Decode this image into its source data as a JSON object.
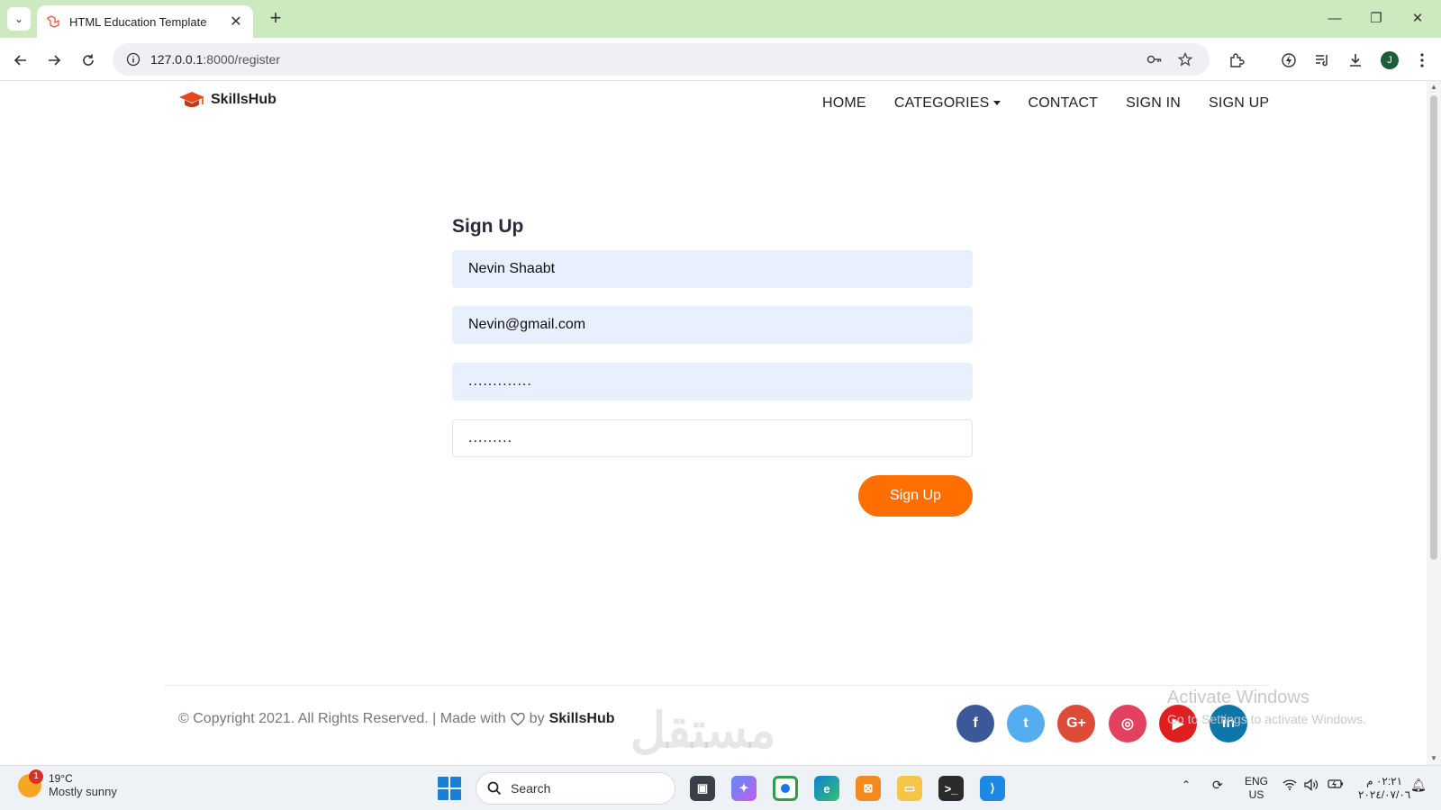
{
  "browser": {
    "tab_title": "HTML Education Template",
    "tab_close": "✕",
    "new_tab": "+",
    "url_host": "127.0.0.1",
    "url_path": ":8000/register",
    "window_controls": {
      "minimize": "—",
      "restore": "❐",
      "close": "✕"
    }
  },
  "site": {
    "logo_text": "SkillsHub",
    "nav": [
      {
        "label": "HOME"
      },
      {
        "label": "CATEGORIES",
        "dropdown": true
      },
      {
        "label": "CONTACT"
      },
      {
        "label": "SIGN IN"
      },
      {
        "label": "SIGN UP"
      }
    ],
    "accent_color": "#ff6f00"
  },
  "form": {
    "title": "Sign Up",
    "name_value": "Nevin Shaabt",
    "email_value": "Nevin@gmail.com",
    "password_value": ".............",
    "confirm_value": ".........",
    "submit_label": "Sign Up"
  },
  "footer": {
    "copyright_prefix": "© Copyright 2021. All Rights Reserved. | Made with",
    "copyright_by": "by",
    "brand": "SkillsHub",
    "social": [
      {
        "name": "facebook",
        "glyph": "f",
        "color": "#3b5998"
      },
      {
        "name": "twitter",
        "glyph": "t",
        "color": "#55acee"
      },
      {
        "name": "google-plus",
        "glyph": "G+",
        "color": "#dd4b39"
      },
      {
        "name": "instagram",
        "glyph": "◎",
        "color": "#e4405f"
      },
      {
        "name": "youtube",
        "glyph": "▶",
        "color": "#e02020"
      },
      {
        "name": "linkedin",
        "glyph": "in",
        "color": "#0e76a8"
      }
    ]
  },
  "overlay": {
    "activate_title": "Activate Windows",
    "activate_sub": "Go to Settings to activate Windows.",
    "watermark": "مستقل"
  },
  "taskbar": {
    "weather_badge": "1",
    "weather_temp": "19°C",
    "weather_desc": "Mostly sunny",
    "search_label": "Search",
    "lang_top": "ENG",
    "lang_bottom": "US",
    "time": "٠٢:٢١ م",
    "date": "٢٠٢٤/٠٧/٠٦"
  }
}
